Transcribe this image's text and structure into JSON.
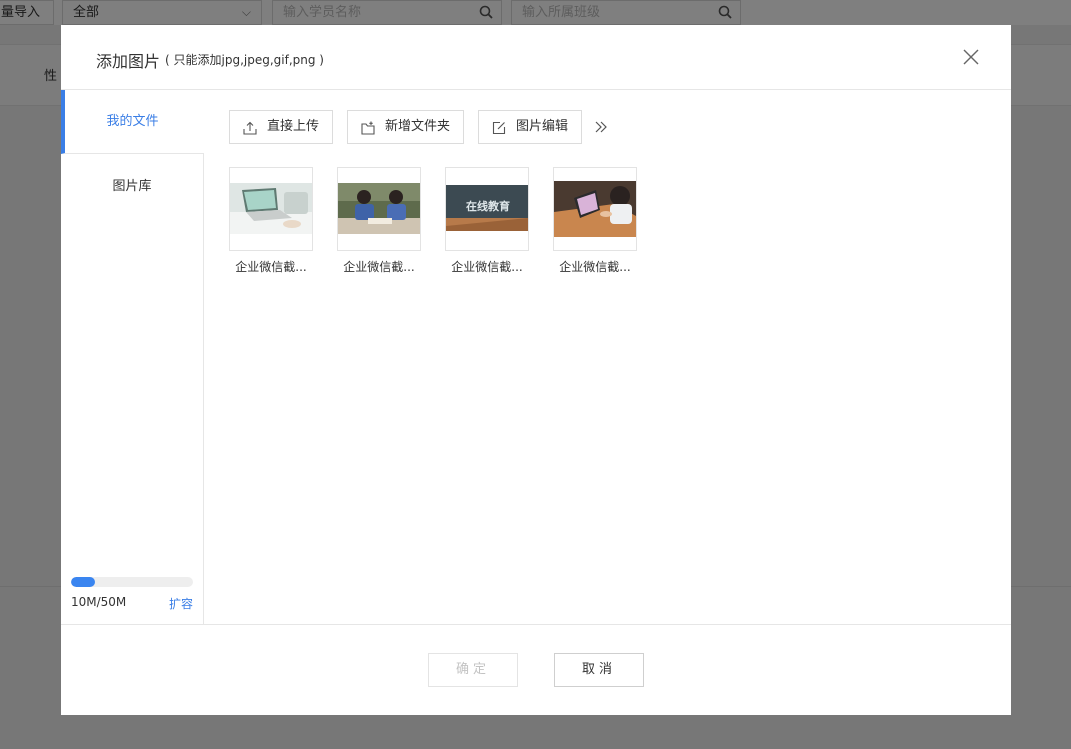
{
  "background": {
    "import_label": "量导入",
    "filter_select": "全部",
    "student_search_placeholder": "输入学员名称",
    "class_search_placeholder": "输入所属班级",
    "column_partial": "性"
  },
  "modal": {
    "title": "添加图片",
    "hint": "( 只能添加jpg,jpeg,gif,png )",
    "sidebar": {
      "items": [
        {
          "label": "我的文件",
          "active": true
        },
        {
          "label": "图片库",
          "active": false
        }
      ],
      "quota": {
        "text": "10M/50M",
        "used_fraction": 0.2,
        "expand_label": "扩容"
      }
    },
    "toolbar": {
      "upload_label": "直接上传",
      "new_folder_label": "新增文件夹",
      "edit_label": "图片编辑"
    },
    "files": [
      {
        "name": "企业微信截...",
        "thumb": "laptop-desk-photo"
      },
      {
        "name": "企业微信截...",
        "thumb": "students-studying-photo"
      },
      {
        "name": "企业微信截...",
        "thumb": "online-education-photo",
        "thumb_text": "在线教育"
      },
      {
        "name": "企业微信截...",
        "thumb": "child-tablet-photo"
      }
    ],
    "footer": {
      "ok_label": "确定",
      "cancel_label": "取消"
    }
  },
  "colors": {
    "accent": "#3a7ee6",
    "quota_fill": "#3a85f0",
    "overlay": "rgba(0,0,0,0.5)"
  }
}
